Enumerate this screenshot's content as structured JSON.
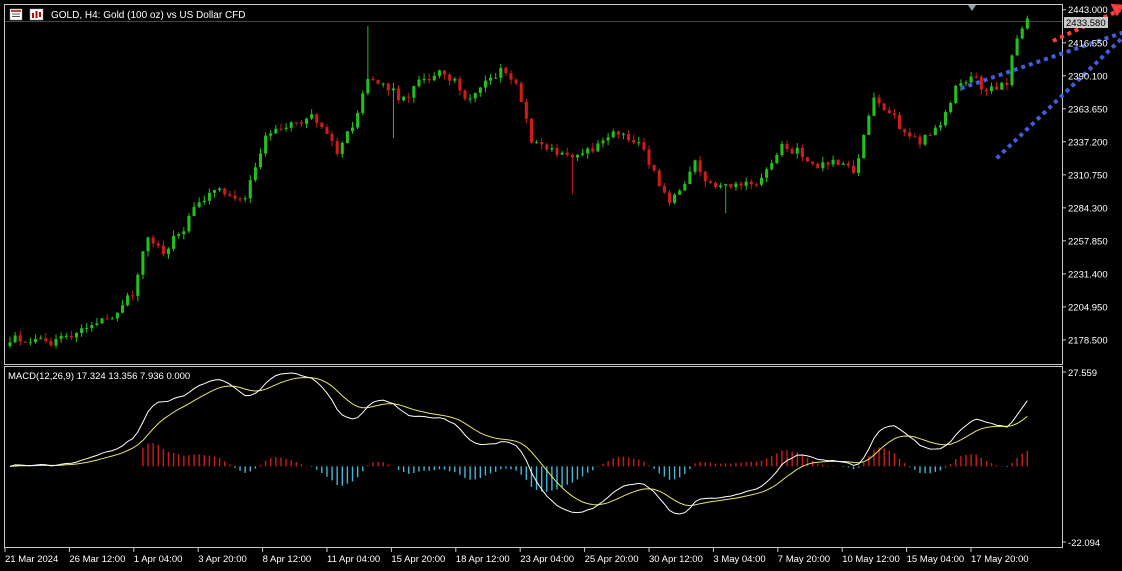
{
  "header": {
    "title": "GOLD, H4:  Gold (100 oz) vs US Dollar CFD"
  },
  "colors": {
    "background": "#000000",
    "bull": "#22c01c",
    "bear": "#d11a1a",
    "frame": "#c8c8c8",
    "trendline": "#3f5ddb",
    "arrow": "#ff3b3b",
    "macd_line": "#ffffff",
    "signal_line": "#e8e864",
    "hist_pos": "#d11a1a",
    "hist_neg": "#3fb8d9"
  },
  "chart_data": [
    {
      "type": "candlestick",
      "title": "GOLD, H4:  Gold (100 oz) vs US Dollar CFD",
      "current_price_label": "2433.580",
      "ylim": [
        2160,
        2446
      ],
      "y_ticks": [
        "2443.000",
        "2416.550",
        "2390.100",
        "2363.650",
        "2337.200",
        "2310.750",
        "2284.300",
        "2257.850",
        "2231.400",
        "2204.950",
        "2178.500"
      ],
      "x_ticks": [
        "21 Mar 2024",
        "26 Mar 12:00",
        "1 Apr 04:00",
        "3 Apr 20:00",
        "8 Apr 12:00",
        "11 Apr 04:00",
        "15 Apr 20:00",
        "18 Apr 12:00",
        "23 Apr 04:00",
        "25 Apr 20:00",
        "30 Apr 12:00",
        "3 May 04:00",
        "7 May 20:00",
        "10 May 12:00",
        "15 May 04:00",
        "17 May 20:00"
      ],
      "close_anchors": [
        [
          0,
          2180
        ],
        [
          8,
          2176
        ],
        [
          15,
          2190
        ],
        [
          20,
          2198
        ],
        [
          24,
          2215
        ],
        [
          27,
          2262
        ],
        [
          30,
          2250
        ],
        [
          34,
          2268
        ],
        [
          37,
          2290
        ],
        [
          40,
          2300
        ],
        [
          43,
          2296
        ],
        [
          46,
          2292
        ],
        [
          50,
          2340
        ],
        [
          55,
          2352
        ],
        [
          59,
          2356
        ],
        [
          62,
          2345
        ],
        [
          64,
          2330
        ],
        [
          67,
          2350
        ],
        [
          70,
          2388
        ],
        [
          74,
          2380
        ],
        [
          77,
          2370
        ],
        [
          80,
          2385
        ],
        [
          84,
          2392
        ],
        [
          87,
          2385
        ],
        [
          90,
          2370
        ],
        [
          93,
          2388
        ],
        [
          97,
          2395
        ],
        [
          99,
          2385
        ],
        [
          102,
          2340
        ],
        [
          106,
          2330
        ],
        [
          110,
          2326
        ],
        [
          114,
          2330
        ],
        [
          118,
          2345
        ],
        [
          122,
          2340
        ],
        [
          125,
          2322
        ],
        [
          127,
          2300
        ],
        [
          129,
          2288
        ],
        [
          132,
          2300
        ],
        [
          134,
          2320
        ],
        [
          136,
          2308
        ],
        [
          140,
          2300
        ],
        [
          143,
          2305
        ],
        [
          146,
          2302
        ],
        [
          148,
          2318
        ],
        [
          151,
          2332
        ],
        [
          154,
          2330
        ],
        [
          157,
          2318
        ],
        [
          160,
          2320
        ],
        [
          163,
          2318
        ],
        [
          165,
          2312
        ],
        [
          167,
          2340
        ],
        [
          169,
          2372
        ],
        [
          172,
          2362
        ],
        [
          175,
          2345
        ],
        [
          178,
          2338
        ],
        [
          182,
          2350
        ],
        [
          185,
          2380
        ],
        [
          188,
          2390
        ],
        [
          191,
          2378
        ],
        [
          195,
          2386
        ],
        [
          197,
          2420
        ],
        [
          199,
          2436
        ]
      ],
      "n_candles": 200
    },
    {
      "type": "macd",
      "indicator_label": "MACD(12,26,9) 17.324 13.356 7.936 0.000",
      "ylim": [
        -22.094,
        27.559
      ],
      "y_ticks": [
        "27.559",
        "-22.094"
      ]
    }
  ],
  "annotations": {
    "trendline_upper": {
      "from": [
        186,
        2380
      ],
      "to": [
        220,
        2428
      ]
    },
    "trendline_lower": {
      "from": [
        193,
        2324
      ],
      "to": [
        219,
        2426
      ]
    },
    "arrow": {
      "from": [
        204,
        2418
      ],
      "to": [
        218,
        2447
      ]
    }
  }
}
